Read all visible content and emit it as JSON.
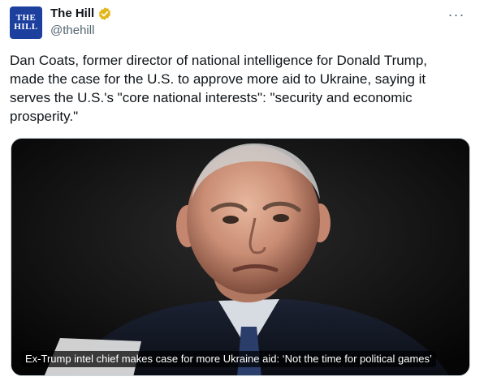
{
  "account": {
    "name": "The Hill",
    "handle": "@thehill",
    "avatar_text": [
      "THE",
      "HILL"
    ],
    "verified_icon": "verified-badge-gold-icon",
    "badge_color": "#e2b719"
  },
  "menu": {
    "icon": "more-horizontal-icon",
    "label": "···"
  },
  "tweet": {
    "text": "Dan Coats, former director of national intelligence for Donald Trump, made the case for the U.S. to approve more aid to Ukraine, saying it serves the U.S.'s \"core national interests\": \"security and economic prosperity.\""
  },
  "card": {
    "headline": "Ex-Trump intel chief makes case for more Ukraine aid: ‘Not the time for political games’"
  }
}
